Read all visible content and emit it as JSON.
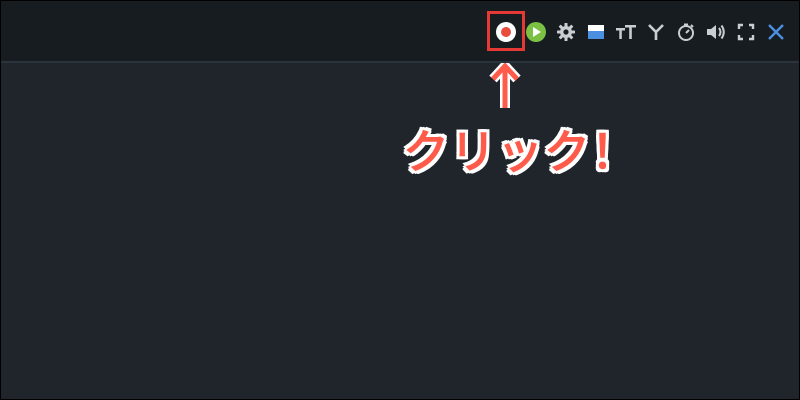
{
  "annotation": {
    "text": "クリック！",
    "color": "#ff5b4a",
    "highlight_color": "#e53935"
  },
  "toolbar": {
    "buttons": [
      {
        "name": "record-button",
        "icon": "record-icon",
        "color": "#e74c3c"
      },
      {
        "name": "play-button",
        "icon": "play-icon",
        "color": "#7ac143"
      },
      {
        "name": "settings-button",
        "icon": "gear-icon"
      },
      {
        "name": "layout-button",
        "icon": "panel-icon",
        "color": "#4b8fe0"
      },
      {
        "name": "text-size-button",
        "icon": "text-size-icon"
      },
      {
        "name": "filter-button",
        "icon": "fork-icon"
      },
      {
        "name": "timer-button",
        "icon": "timer-icon"
      },
      {
        "name": "volume-button",
        "icon": "speaker-icon"
      },
      {
        "name": "fullscreen-button",
        "icon": "fullscreen-icon"
      },
      {
        "name": "close-button",
        "icon": "close-icon",
        "color": "#4b8fe0"
      }
    ]
  }
}
